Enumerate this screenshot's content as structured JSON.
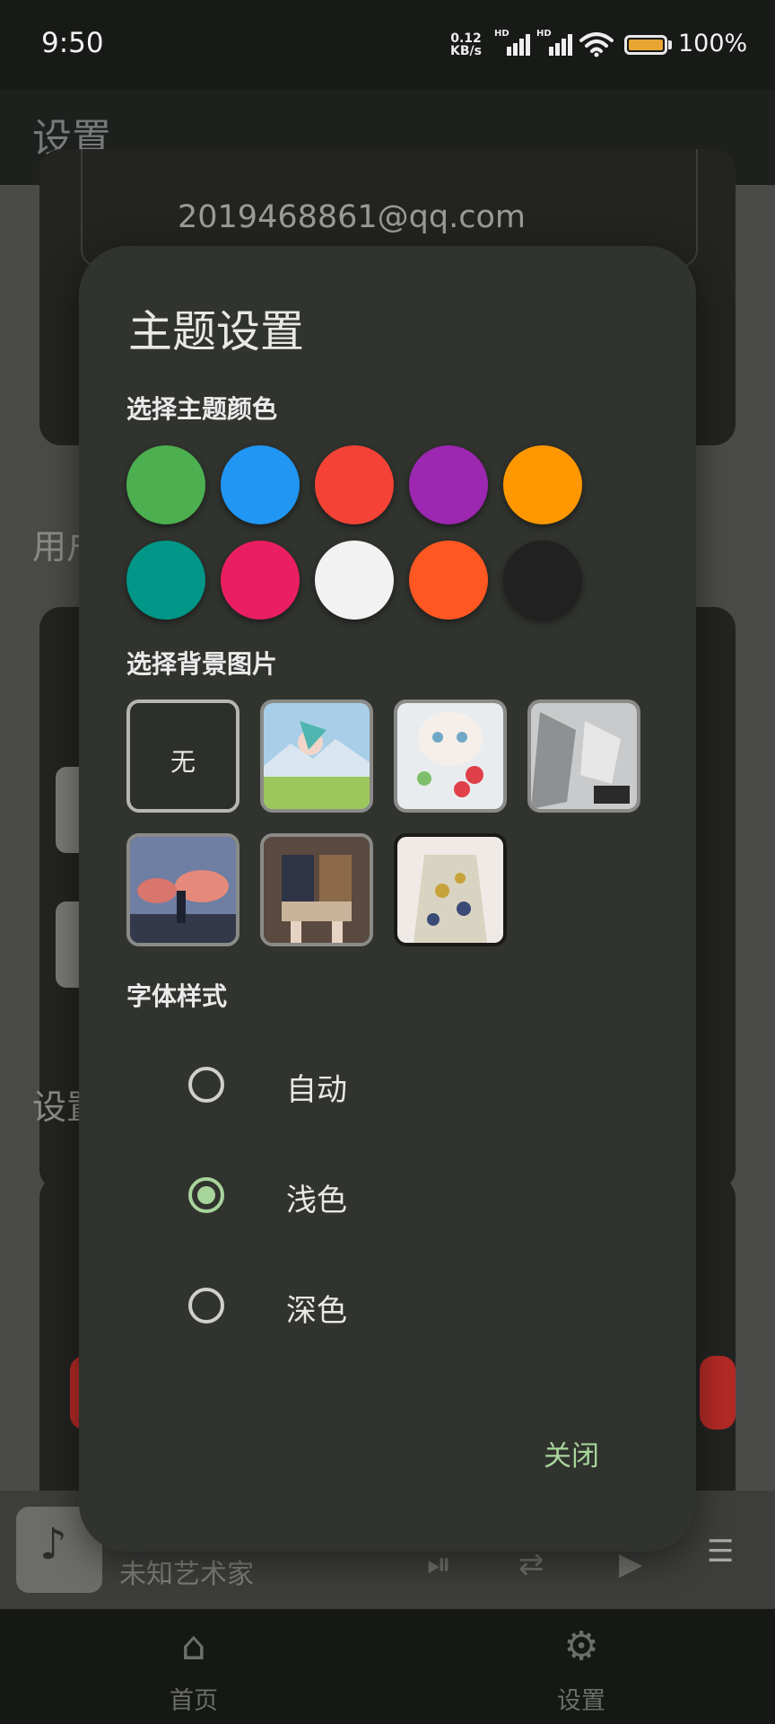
{
  "status_bar": {
    "time": "9:50",
    "net_speed_value": "0.12",
    "net_speed_unit": "KB/s",
    "hd1": "HD",
    "hd2": "HD",
    "battery": "100%",
    "battery_color": "#e8a534"
  },
  "app_bar": {
    "title": "设置"
  },
  "background": {
    "email": "2019468861@qq.com",
    "section_user_partial": "用户",
    "section_settings_partial": "设置"
  },
  "player": {
    "artist": "未知艺术家",
    "icons": [
      "music-note-icon",
      "play-pause-icon",
      "repeat-icon",
      "next-icon",
      "playlist-icon"
    ]
  },
  "bottom_nav": {
    "items": [
      {
        "label": "首页",
        "icon": "home-icon"
      },
      {
        "label": "设置",
        "icon": "gear-icon"
      }
    ]
  },
  "dialog": {
    "title": "主题设置",
    "color_section": "选择主题颜色",
    "colors": [
      "#4caf50",
      "#2196f3",
      "#f44336",
      "#9c27b0",
      "#ff9800",
      "#009688",
      "#e91e63",
      "#f2f2f2",
      "#ff5722",
      "#212121"
    ],
    "background_section": "选择背景图片",
    "background_none": "无",
    "background_thumbnails": 6,
    "font_section": "字体样式",
    "font_options": [
      "自动",
      "浅色",
      "深色"
    ],
    "font_selected": "浅色",
    "accent_color": "#a7d49b",
    "close_label": "关闭"
  }
}
